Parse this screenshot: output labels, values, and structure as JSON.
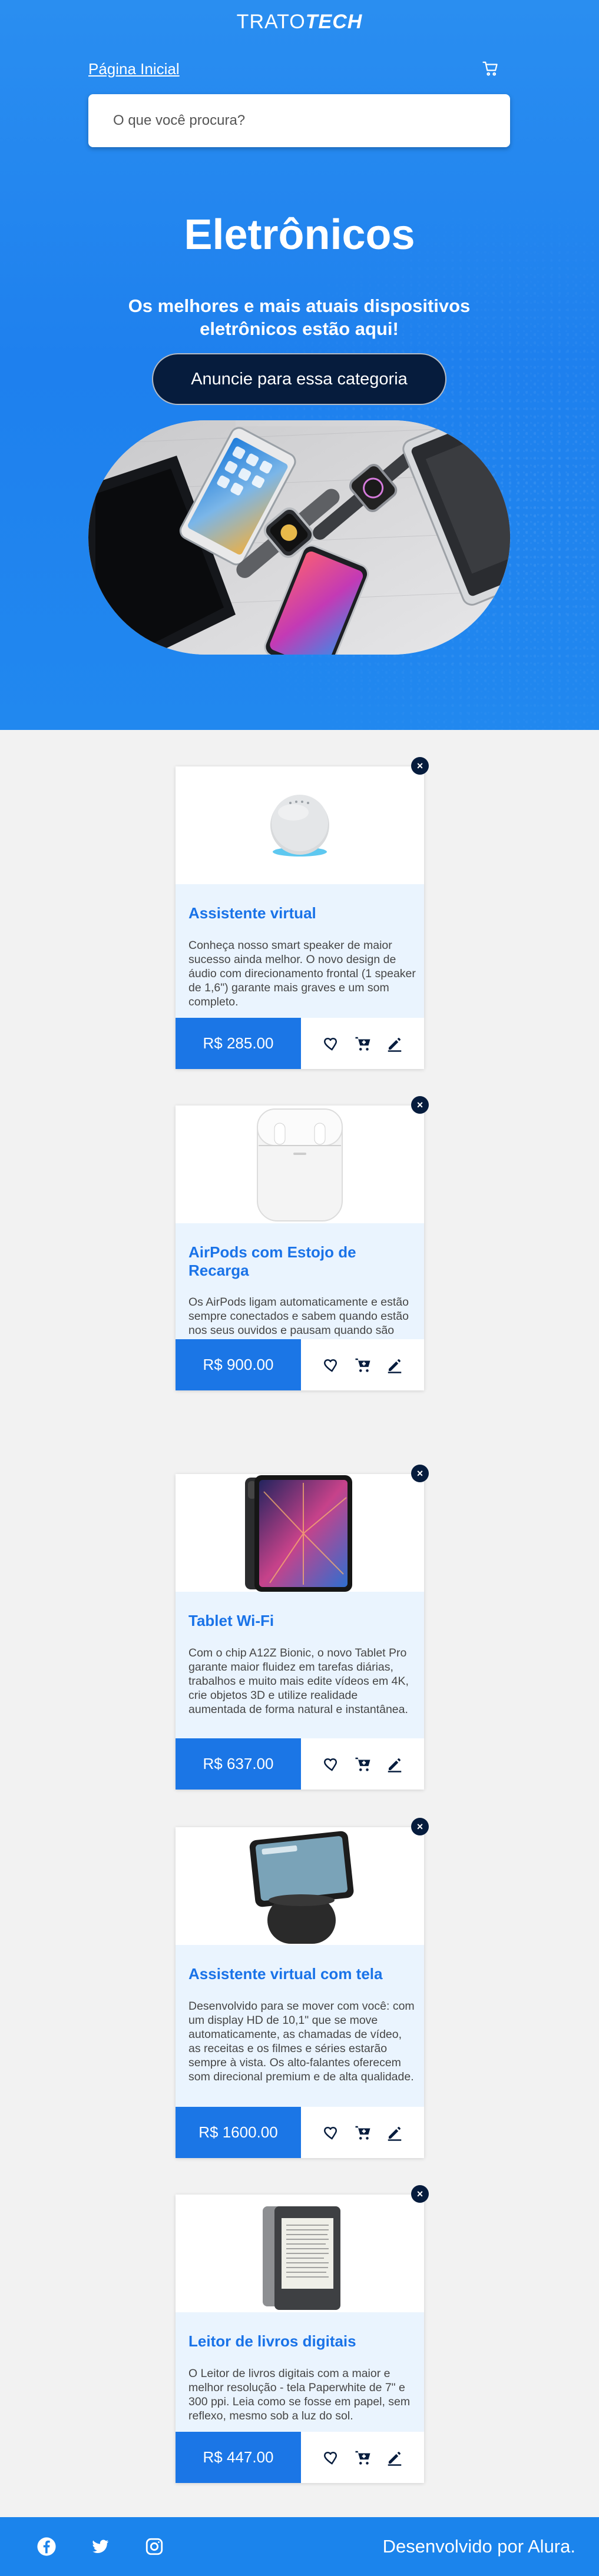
{
  "header": {
    "logo_part1": "TRATO",
    "logo_part2": "TECH",
    "home_link": "Página Inicial",
    "search_placeholder": "O que você procura?"
  },
  "hero": {
    "title": "Eletrônicos",
    "subtitle": "Os melhores e mais atuais dispositivos eletrônicos estão aqui!",
    "cta_label": "Anuncie para essa categoria"
  },
  "products": [
    {
      "name": "Assistente virtual",
      "description": "Conheça nosso smart speaker de maior sucesso ainda melhor. O novo design de áudio com direcionamento frontal (1 speaker de 1,6\") garante mais graves e um som completo.",
      "price": "R$ 285.00"
    },
    {
      "name": "AirPods com Estojo de Recarga",
      "description": "Os AirPods ligam automaticamente e estão sempre conectados e sabem quando estão nos seus ouvidos e pausam quando são tirados. Para ajustar o volume, trocar de música, fazer uma ligação.",
      "price": "R$ 900.00"
    },
    {
      "name": "Tablet Wi-Fi",
      "description": "Com o chip A12Z Bionic, o novo Tablet Pro garante maior fluidez em tarefas diárias, trabalhos e muito mais edite vídeos em 4K, crie objetos 3D e utilize realidade aumentada de forma natural e instantânea.",
      "price": "R$ 637.00"
    },
    {
      "name": "Assistente virtual com tela",
      "description": "Desenvolvido para se mover com você: com um display HD de 10,1\" que se move automaticamente, as chamadas de vídeo, as receitas e os filmes e séries estarão sempre à vista. Os alto-falantes oferecem som direcional premium e de alta qualidade.",
      "price": "R$ 1600.00"
    },
    {
      "name": "Leitor de livros digitais",
      "description": "O Leitor de livros digitais com a maior e melhor resolução - tela Paperwhite de 7\" e 300 ppi. Leia como se fosse em papel, sem reflexo, mesmo sob a luz do sol.",
      "price": "R$ 447.00"
    }
  ],
  "card_icons": [
    "heart-icon",
    "cart-icon",
    "pencil-icon"
  ],
  "close_symbol": "×",
  "footer": {
    "credit": "Desenvolvido por Alura.",
    "social": [
      "facebook-icon",
      "twitter-icon",
      "instagram-icon"
    ]
  },
  "colors": {
    "hero_blue": "#2188ef",
    "price_blue": "#1b76e6",
    "title_blue": "#1a73e8",
    "navy": "#061c3d",
    "card_bg": "#eaf4fe"
  }
}
